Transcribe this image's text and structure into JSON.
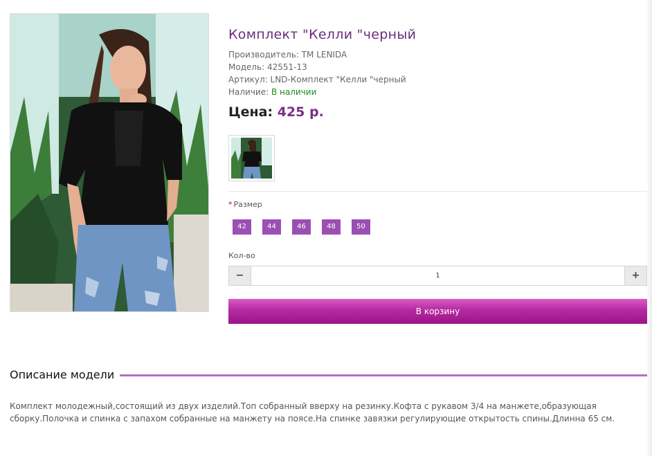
{
  "product": {
    "title": "Комплект \"Келли \"черный",
    "manufacturer_label": "Производитель:",
    "manufacturer_value": "TM LENIDA",
    "model_label": "Модель:",
    "model_value": "42551-13",
    "sku_label": "Артикул:",
    "sku_value": "LND-Комплект \"Келли \"черный",
    "availability_label": "Наличие:",
    "availability_value": "В наличии",
    "price_label": "Цена:",
    "price_value": "425 р."
  },
  "options": {
    "size_required_mark": "*",
    "size_label": "Размер",
    "sizes": [
      "42",
      "44",
      "46",
      "48",
      "50"
    ]
  },
  "quantity": {
    "label": "Кол-во",
    "value": "1",
    "minus_icon": "minus-icon",
    "plus_icon": "plus-icon"
  },
  "cart": {
    "button_label": "В корзину"
  },
  "description": {
    "heading": "Описание модели",
    "text": "Комплект молодежный,состоящий из двух изделий.Топ собранный вверху на резинку.Кофта с рукавом 3/4 на манжете,образующая сборку.Полочка и спинка с запахом собранные на манжету на поясе.На спинке завязки регулирующие открытость спины.Длинна 65 см."
  },
  "colors": {
    "accent": "#6a2d7e",
    "size_button": "#9b4fb3",
    "cart_button": "#b52aa0",
    "in_stock": "#1a8a1a"
  }
}
